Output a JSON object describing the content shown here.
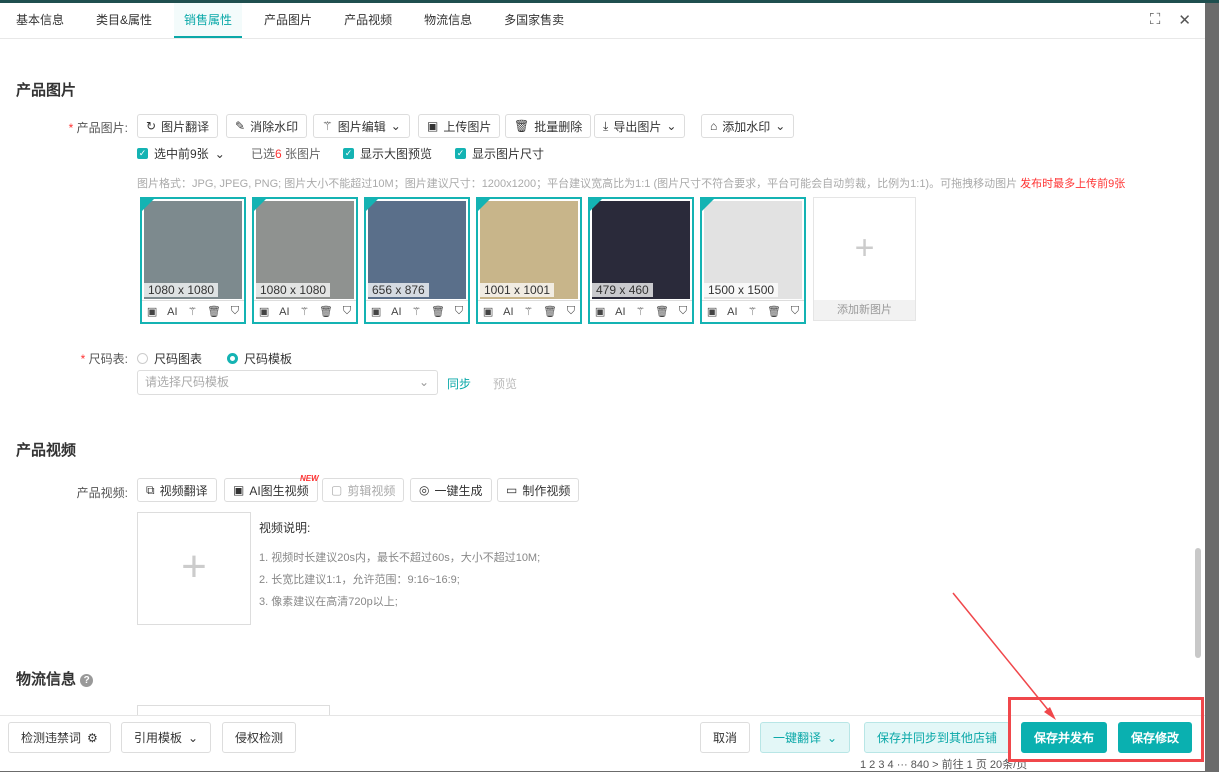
{
  "tabs": [
    "基本信息",
    "类目&属性",
    "销售属性",
    "产品图片",
    "产品视频",
    "物流信息",
    "多国家售卖"
  ],
  "active_tab": "销售属性",
  "images_section": {
    "title": "产品图片",
    "label": "产品图片:",
    "buttons": [
      "图片翻译",
      "消除水印",
      "图片编辑",
      "上传图片",
      "批量删除",
      "导出图片",
      "添加水印"
    ],
    "select_first": "选中前9张",
    "selected_prefix": "已选",
    "selected_count": "6",
    "selected_suffix": " 张图片",
    "show_preview": "显示大图预览",
    "show_size": "显示图片尺寸",
    "hint": "图片格式：JPG, JPEG, PNG; 图片大小不能超过10M；图片建议尺寸：1200x1200；平台建议宽高比为1:1 (图片尺寸不符合要求，平台可能会自动剪裁，比例为1:1)。可拖拽移动图片",
    "hint_red": "发布时最多上传前9张",
    "images": [
      {
        "size": "1080 x 1080",
        "color": "#7d8a8e"
      },
      {
        "size": "1080 x 1080",
        "color": "#8f9290"
      },
      {
        "size": "656 x 876",
        "color": "#5a6f8a"
      },
      {
        "size": "1001 x 1001",
        "color": "#c8b58a"
      },
      {
        "size": "479 x 460",
        "color": "#2a2a3a"
      },
      {
        "size": "1500 x 1500",
        "color": "#e2e2e2"
      }
    ],
    "tile_tools": [
      "image-icon",
      "AI",
      "magic-icon",
      "trash-icon",
      "shield-icon"
    ],
    "ai_label": "AI",
    "add_image": "添加新图片"
  },
  "size_chart": {
    "label": "尺码表:",
    "opt1": "尺码图表",
    "opt2": "尺码模板",
    "placeholder": "请选择尺码模板",
    "sync": "同步",
    "preview": "预览"
  },
  "video_section": {
    "title": "产品视频",
    "label": "产品视频:",
    "buttons": [
      "视频翻译",
      "AI图生视频",
      "剪辑视频",
      "一键生成",
      "制作视频"
    ],
    "new_badge": "NEW",
    "desc_title": "视频说明:",
    "notes": [
      "1. 视频时长建议20s内，最长不超过60s，大小不超过10M;",
      "2. 长宽比建议1:1，允许范围：9:16~16:9;",
      "3. 像素建议在高清720p以上;"
    ]
  },
  "logistics": {
    "title": "物流信息"
  },
  "footer": {
    "detect": "检测违禁词",
    "template": "引用模板",
    "infringe": "侵权检测",
    "cancel": "取消",
    "translate": "一键翻译",
    "sync_save": "保存并同步到其他店铺",
    "save_publish": "保存并发布",
    "save_edit": "保存修改"
  },
  "pager": "1  2  3  4  ···  840  >  前往  1  页   20条/页"
}
